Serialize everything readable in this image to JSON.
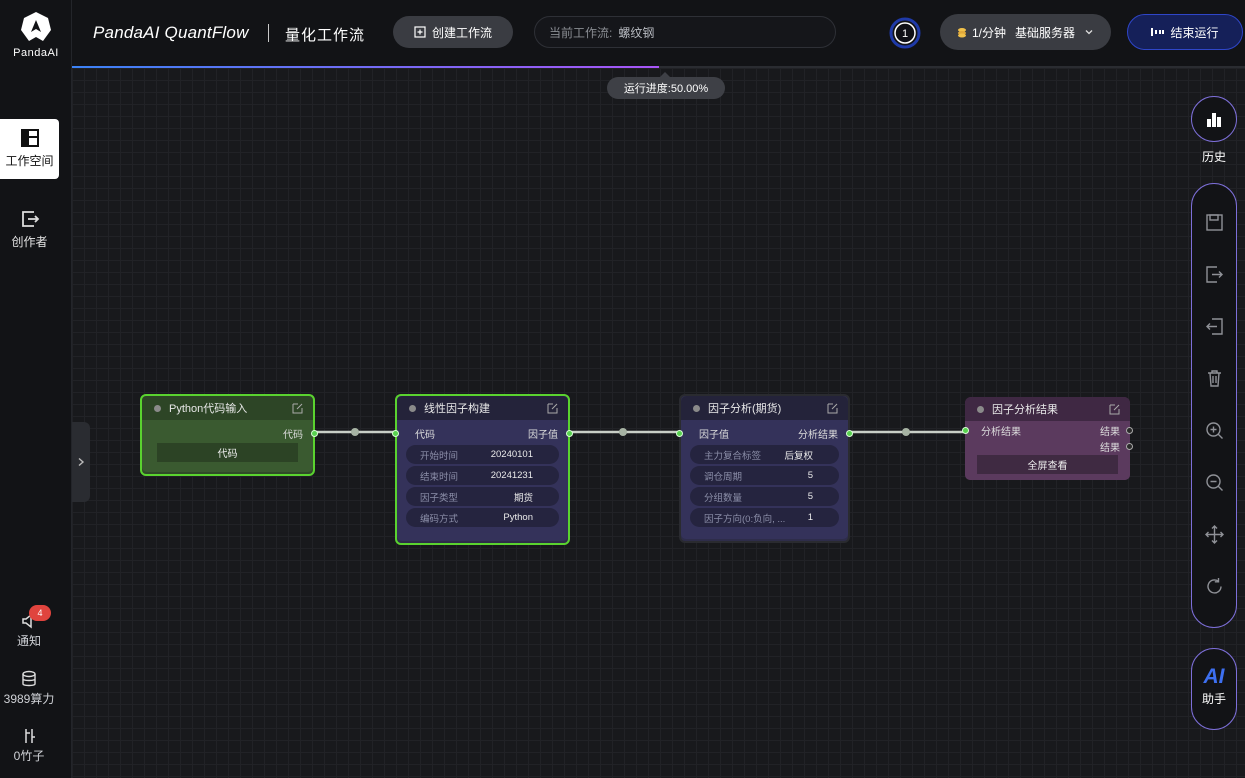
{
  "brand": {
    "name": "PandaAI"
  },
  "sidebar": {
    "items": [
      {
        "label": "工作空间",
        "active": true
      },
      {
        "label": "创作者",
        "active": false
      }
    ],
    "bottom": {
      "notify_label": "通知",
      "notify_count": "4",
      "compute_label": "3989算力",
      "bamboo_label": "0竹子"
    }
  },
  "header": {
    "title": "PandaAI QuantFlow",
    "subtitle": "量化工作流",
    "create_label": "创建工作流",
    "current_label": "当前工作流:",
    "current_value": "螺纹钢",
    "queue_count": "1",
    "rate_label": "1/分钟",
    "server_label": "基础服务器",
    "stop_label": "结束运行"
  },
  "progress": {
    "fraction": 0.5,
    "tip": "运行进度:50.00%"
  },
  "nodes": {
    "python": {
      "title": "Python代码输入",
      "out_label": "代码",
      "button": "代码"
    },
    "linear": {
      "title": "线性因子构建",
      "in_label": "代码",
      "out_label": "因子值",
      "widgets": [
        {
          "k": "开始时间",
          "v": "20240101"
        },
        {
          "k": "结束时间",
          "v": "20241231"
        },
        {
          "k": "因子类型",
          "v": "期货"
        },
        {
          "k": "编码方式",
          "v": "Python"
        }
      ]
    },
    "analysis": {
      "title": "因子分析(期货)",
      "in_label": "因子值",
      "out_label": "分析结果",
      "widgets": [
        {
          "k": "主力复合标签",
          "v": "后复权"
        },
        {
          "k": "调仓周期",
          "v": "5"
        },
        {
          "k": "分组数量",
          "v": "5"
        },
        {
          "k": "因子方向(0:负向, ...",
          "v": "1"
        }
      ]
    },
    "result": {
      "title": "因子分析结果",
      "in_label": "分析结果",
      "out1": "结果",
      "out2": "结果",
      "button": "全屏查看"
    }
  },
  "right_toolbar": {
    "history_label": "历史",
    "tools": [
      "save-icon",
      "export-icon",
      "import-icon",
      "delete-icon",
      "zoom-in-icon",
      "zoom-out-icon",
      "move-icon",
      "refresh-icon"
    ],
    "ai_title": "AI",
    "ai_label": "助手"
  },
  "colors": {
    "accent": "#2f46c9",
    "node_green": "#3a5a2e",
    "node_purple": "#2d2d4e",
    "node_magenta": "#5b3a5e"
  }
}
